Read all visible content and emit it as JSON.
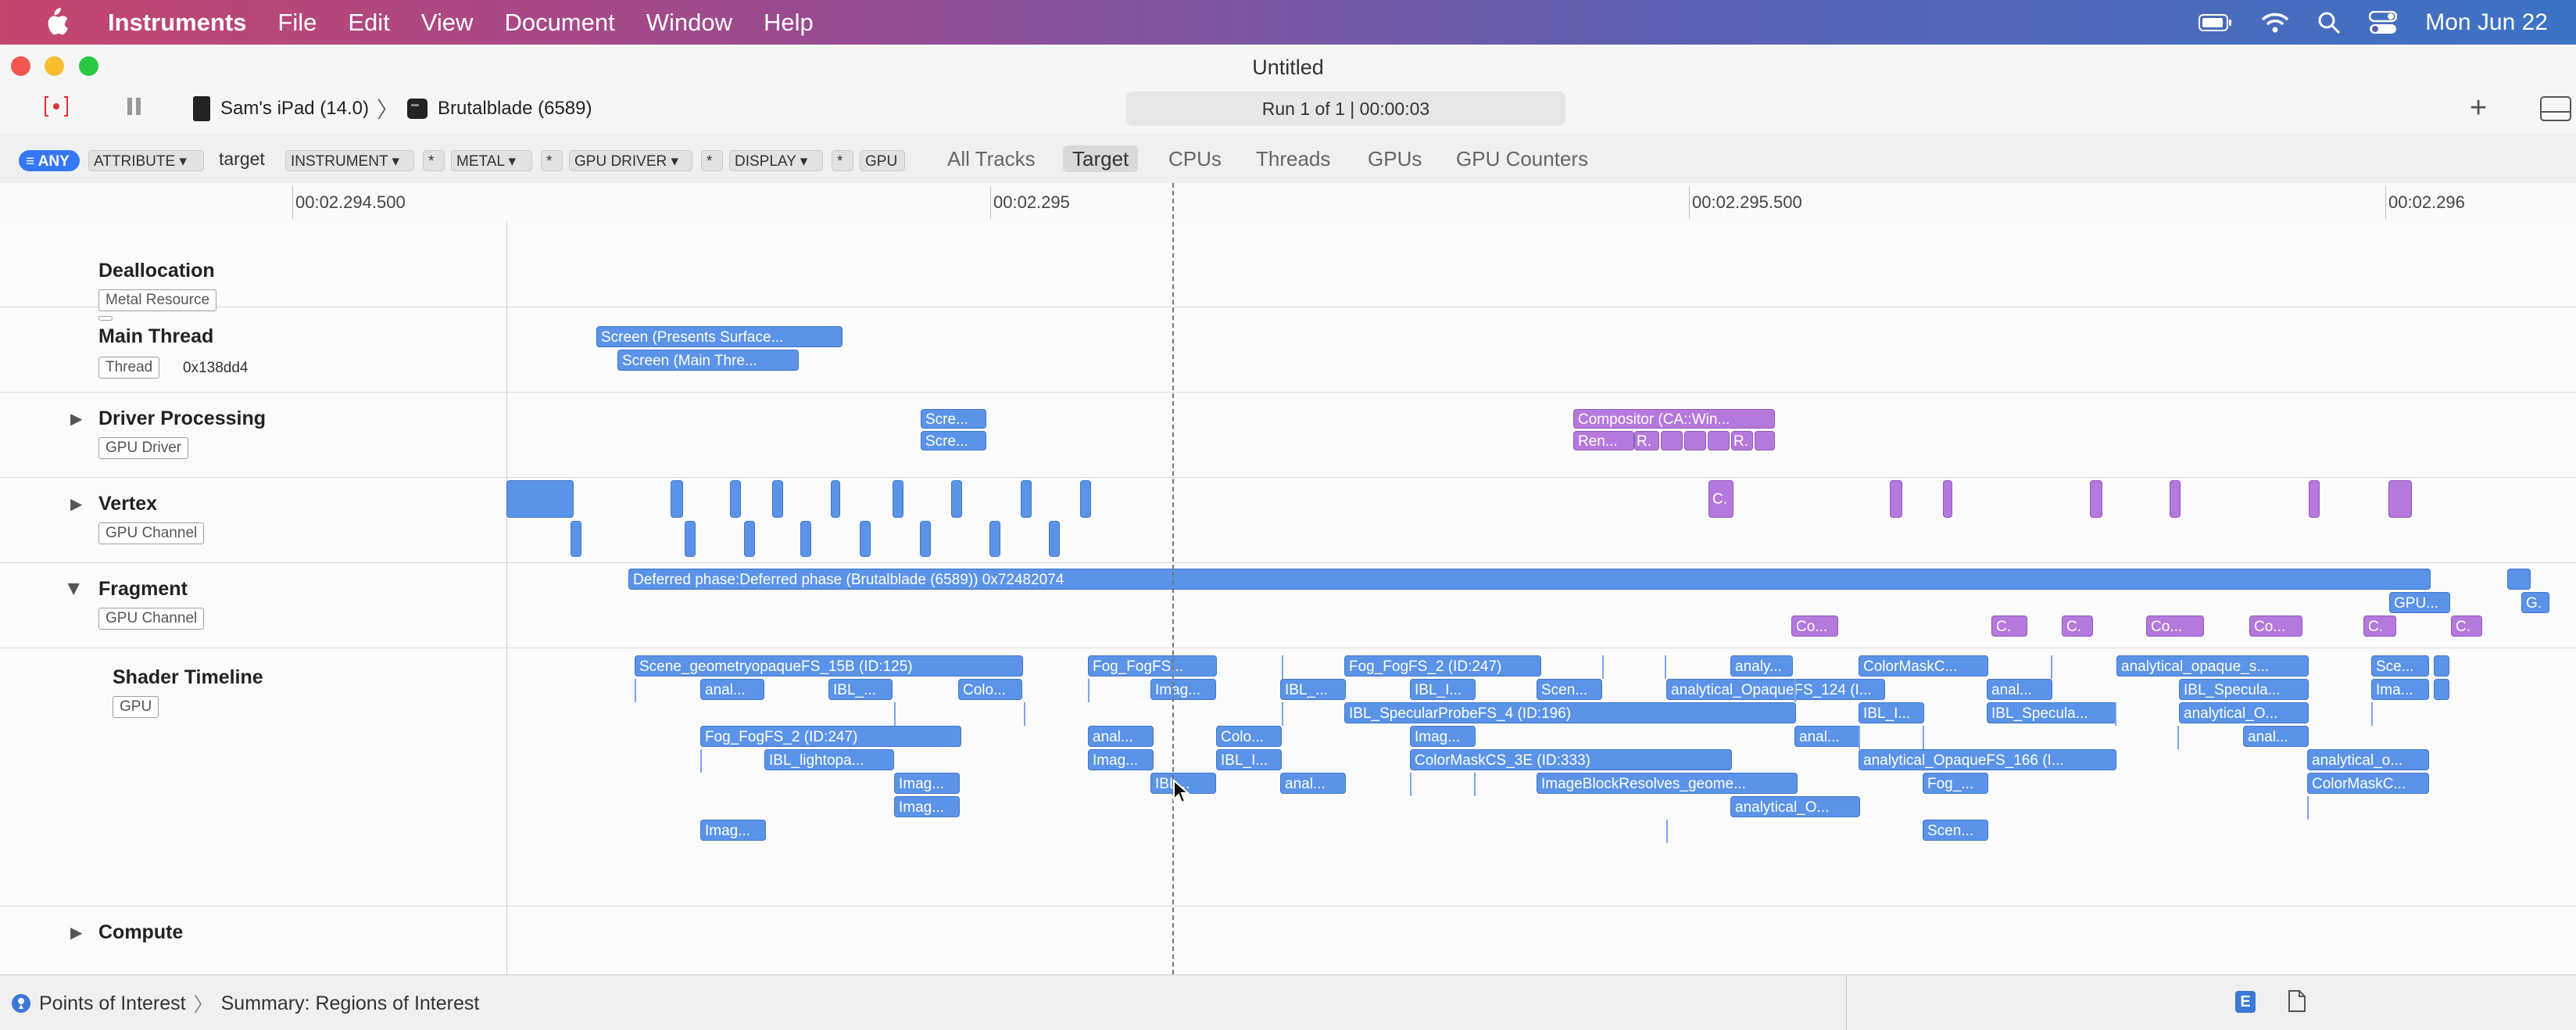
{
  "menubar": {
    "app": "Instruments",
    "items": [
      "File",
      "Edit",
      "View",
      "Document",
      "Window",
      "Help"
    ],
    "clock": "Mon Jun 22"
  },
  "window": {
    "title": "Untitled",
    "device": "Sam's iPad (14.0)",
    "target": "Brutalblade (6589)",
    "run_status": "Run 1 of 1  |  00:00:03"
  },
  "filter": {
    "any_label": "ANY",
    "attribute": "ATTRIBUTE",
    "target_text": "target",
    "instrument": "INSTRUMENT",
    "metal": "METAL",
    "gpu_driver": "GPU DRIVER",
    "display": "DISPLAY",
    "gpu": "GPU",
    "star": "*"
  },
  "tabs": [
    "All Tracks",
    "Target",
    "CPUs",
    "Threads",
    "GPUs",
    "GPU Counters"
  ],
  "ruler": [
    "00:02.294.500",
    "00:02.295",
    "00:02.295.500",
    "00:02.296"
  ],
  "tracks": {
    "dealloc": {
      "name": "Deallocation",
      "badge": "Metal Resource"
    },
    "main": {
      "name": "Main Thread",
      "badge": "Thread",
      "sub": "0x138dd4"
    },
    "driver": {
      "name": "Driver Processing",
      "badge": "GPU Driver"
    },
    "vertex": {
      "name": "Vertex",
      "badge": "GPU Channel"
    },
    "fragment": {
      "name": "Fragment",
      "badge": "GPU Channel"
    },
    "shader": {
      "name": "Shader Timeline",
      "badge": "GPU"
    },
    "compute": {
      "name": "Compute"
    }
  },
  "events": {
    "main": [
      "Screen (Presents Surface...",
      "Screen (Main Thre..."
    ],
    "driver": [
      "Scre...",
      "Scre...",
      "Compositor (CA::Win...",
      "Ren...",
      "R.",
      "R."
    ],
    "vertex": [
      "C."
    ],
    "fragment": [
      "Deferred phase:Deferred phase (Brutalblade (6589)) 0x72482074",
      "GPU...",
      "G.",
      "Co...",
      "C.",
      "C.",
      "Co...",
      "Co...",
      "C.",
      "C."
    ],
    "shader": [
      "Scene_geometryopaqueFS_15B (ID:125)",
      "Fog_FogFS...",
      "Fog_FogFS_2 (ID:247)",
      "analy...",
      "ColorMaskC...",
      "analytical_opaque_s...",
      "Sce...",
      "anal...",
      "IBL_...",
      "Colo...",
      "Imag...",
      "IBL_...",
      "IBL_I...",
      "Scen...",
      "analytical_OpaqueFS_124 (I...",
      "anal...",
      "IBL_Specula...",
      "Ima...",
      "IBL_SpecularProbeFS_4 (ID:196)",
      "IBL_I...",
      "IBL_Specula...",
      "analytical_O...",
      "Fog_FogFS_2 (ID:247)",
      "anal...",
      "Colo...",
      "Imag...",
      "anal...",
      "anal...",
      "IBL_lightopa...",
      "Imag...",
      "IBL_I...",
      "ColorMaskCS_3E (ID:333)",
      "analytical_OpaqueFS_166 (I...",
      "analytical_o...",
      "Imag...",
      "IBL...",
      "anal...",
      "ImageBlockResolves_geome...",
      "Fog_...",
      "ColorMaskC...",
      "Imag...",
      "analytical_O...",
      "Imag...",
      "Scen..."
    ]
  },
  "status": {
    "left": "Points of Interest",
    "right": "Summary: Regions of Interest"
  },
  "icons": [
    "apple-icon",
    "battery-icon",
    "wifi-icon",
    "search-icon",
    "control-center-icon",
    "record-icon",
    "pause-icon",
    "ipad-icon",
    "app-icon",
    "plus-icon",
    "layout-icon",
    "filter-icon",
    "disclosure-icon",
    "poi-icon",
    "info-icon",
    "doc-icon"
  ],
  "colors": {
    "cpu_event": "#5b93e8",
    "gpu_event": "#b578dc",
    "accent": "#3478f6"
  }
}
